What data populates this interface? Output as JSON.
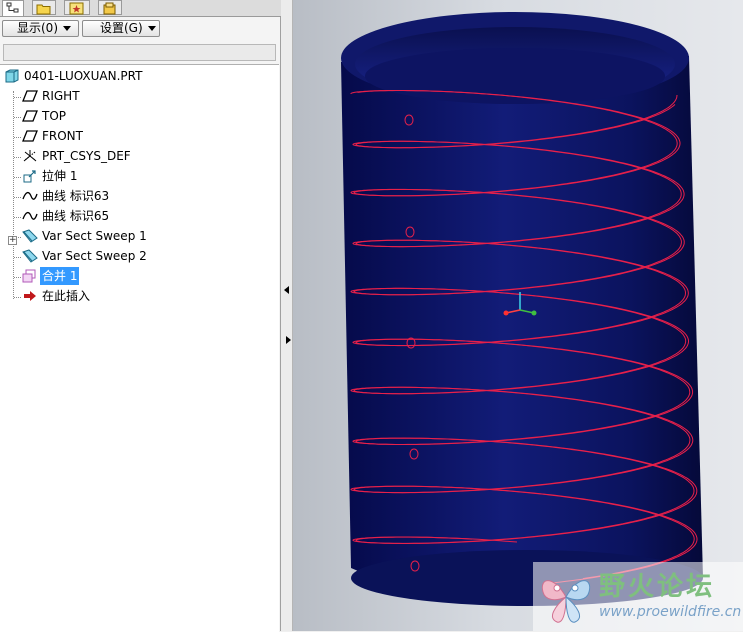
{
  "toolbar": {
    "show_label": "显示(0)",
    "settings_label": "设置(G)"
  },
  "tree": {
    "items": [
      {
        "label": "0401-LUOXUAN.PRT",
        "icon": "part-icon"
      },
      {
        "label": "RIGHT",
        "icon": "datum-plane-icon"
      },
      {
        "label": "TOP",
        "icon": "datum-plane-icon"
      },
      {
        "label": "FRONT",
        "icon": "datum-plane-icon"
      },
      {
        "label": "PRT_CSYS_DEF",
        "icon": "coordinate-system-icon"
      },
      {
        "label": "拉伸 1",
        "icon": "extrude-icon"
      },
      {
        "label": "曲线 标识63",
        "icon": "curve-icon"
      },
      {
        "label": "曲线 标识65",
        "icon": "curve-icon"
      },
      {
        "label": "Var Sect Sweep 1",
        "icon": "sweep-icon"
      },
      {
        "label": "Var Sect Sweep 2",
        "icon": "sweep-icon"
      },
      {
        "label": "合并 1",
        "icon": "merge-icon",
        "selected": true
      },
      {
        "label": "在此插入",
        "icon": "insert-here-arrow-icon"
      }
    ]
  },
  "watermark": {
    "title": "野火论坛",
    "url": "www.proewildfire.cn"
  },
  "colors": {
    "cylinder": "#0d1566",
    "helix": "#e8204a",
    "selection": "#3399ff"
  }
}
